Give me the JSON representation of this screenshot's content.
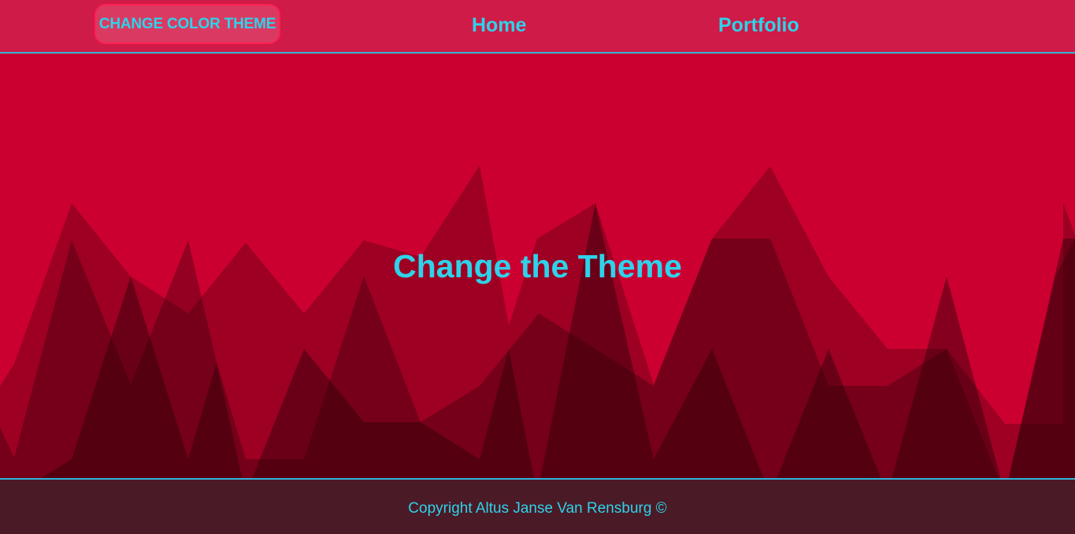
{
  "navbar": {
    "theme_button_label": "CHANGE COLOR THEME",
    "links": [
      {
        "label": "Home"
      },
      {
        "label": "Portfolio"
      }
    ]
  },
  "hero": {
    "title": "Change the Theme"
  },
  "footer": {
    "copyright": "Copyright Altus Janse Van Rensburg ©"
  },
  "colors": {
    "background": "#cc0030",
    "navbar": "#cf1b47",
    "accent_text": "#2ed3ea",
    "divider": "#2fb6d6",
    "footer": "#4a1a26"
  }
}
